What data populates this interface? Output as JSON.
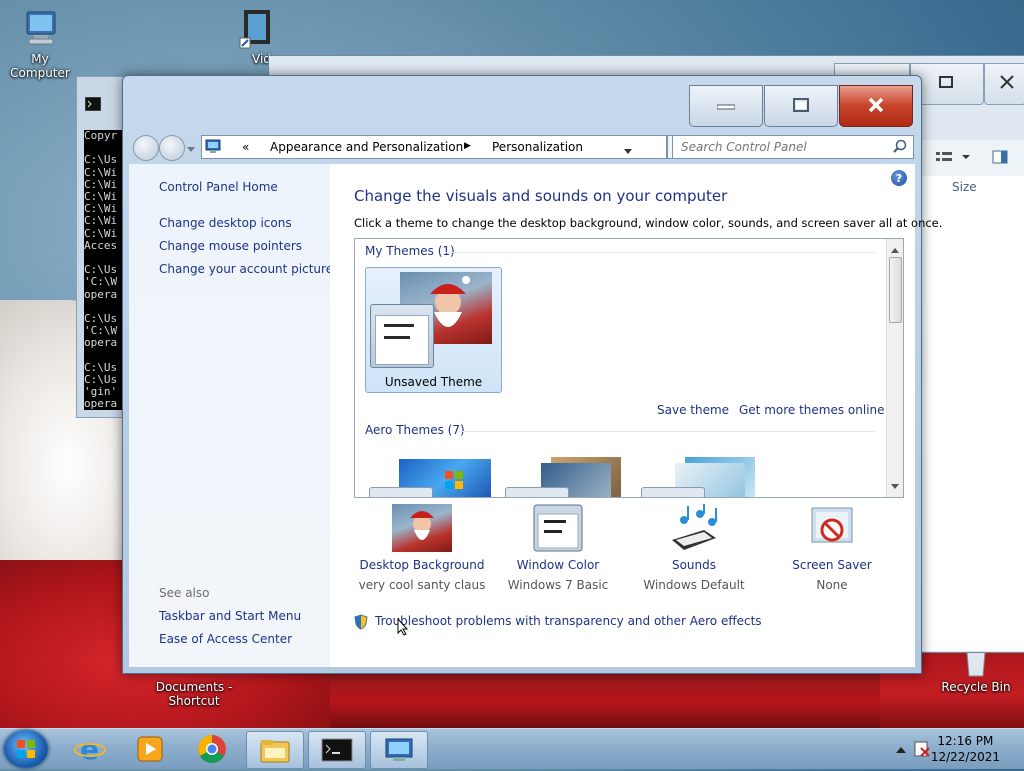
{
  "desktop": {
    "icons": [
      {
        "label": "My Computer"
      },
      {
        "label": "Vid"
      },
      {
        "label": "Documents - Shortcut"
      },
      {
        "label": "Recycle Bin"
      }
    ]
  },
  "cmd_window": {
    "lines": [
      "Copyr",
      "",
      "C:\\Us",
      "C:\\Wi",
      "C:\\Wi",
      "C:\\Wi",
      "C:\\Wi",
      "C:\\Wi",
      "C:\\Wi",
      "Acces",
      "",
      "C:\\Us",
      "'C:\\W",
      "opera",
      "",
      "C:\\Us",
      "'C:\\W",
      "opera",
      "",
      "C:\\Us",
      "C:\\Us",
      "'gin'",
      "opera"
    ]
  },
  "background_window": {
    "column_size": "Size"
  },
  "window": {
    "breadcrumb": {
      "overflow": "«",
      "items": [
        "Appearance and Personalization",
        "Personalization"
      ]
    },
    "search_placeholder": "Search Control Panel",
    "help": "?",
    "sidebar": {
      "home": "Control Panel Home",
      "links": [
        "Change desktop icons",
        "Change mouse pointers",
        "Change your account picture"
      ],
      "see_also_label": "See also",
      "see_also": [
        "Taskbar and Start Menu",
        "Ease of Access Center"
      ]
    },
    "content": {
      "title": "Change the visuals and sounds on your computer",
      "subtitle": "Click a theme to change the desktop background, window color, sounds, and screen saver all at once.",
      "my_themes_header": "My Themes (1)",
      "unsaved_theme": "Unsaved Theme",
      "save_theme": "Save theme",
      "get_more": "Get more themes online",
      "aero_header": "Aero Themes (7)",
      "bottom": [
        {
          "label": "Desktop Background",
          "sub": "very cool santy claus"
        },
        {
          "label": "Window Color",
          "sub": "Windows 7 Basic"
        },
        {
          "label": "Sounds",
          "sub": "Windows Default"
        },
        {
          "label": "Screen Saver",
          "sub": "None"
        }
      ],
      "troubleshoot": "Troubleshoot problems with transparency and other Aero effects"
    }
  },
  "taskbar": {
    "time": "12:16 PM",
    "date": "12/22/2021"
  },
  "colors": {
    "link": "#1e3287",
    "close_red": "#c8432b",
    "santa_red": "#c21e23"
  }
}
